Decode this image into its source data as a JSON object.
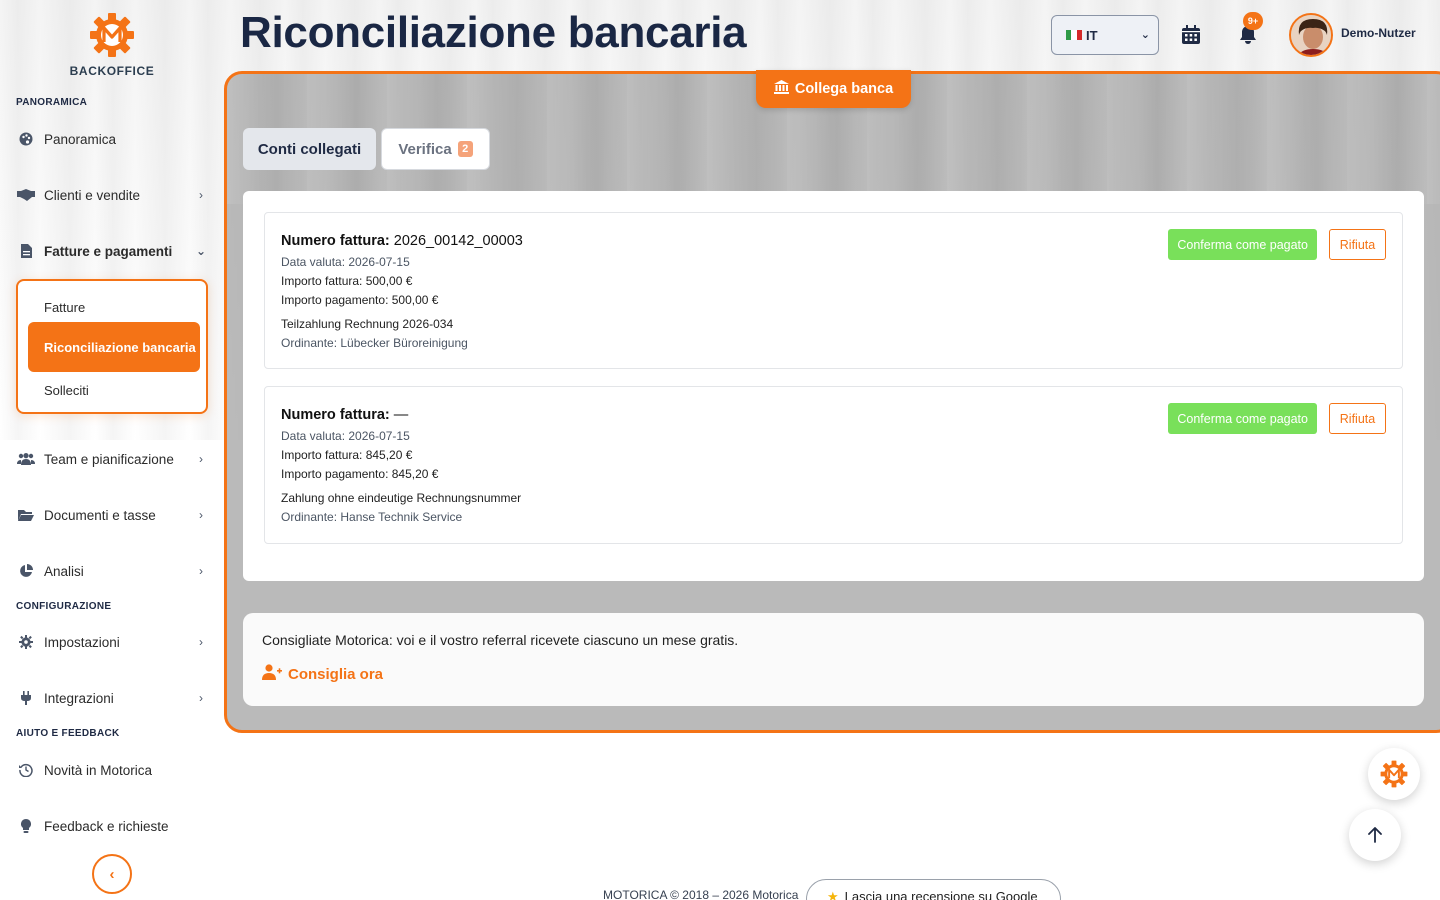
{
  "brand": {
    "logo_text": "BACKOFFICE",
    "accent": "#f47316"
  },
  "sidebar": {
    "sections": {
      "overview": "PANORAMICA",
      "config": "CONFIGURAZIONE",
      "help": "AIUTO E FEEDBACK"
    },
    "items": {
      "overview": {
        "label": "Panoramica",
        "icon": "palette-icon"
      },
      "clients": {
        "label": "Clienti e vendite",
        "icon": "handshake-icon"
      },
      "invoices": {
        "label": "Fatture e pagamenti",
        "icon": "invoice-icon"
      },
      "team": {
        "label": "Team e pianificazione",
        "icon": "users-icon"
      },
      "documents": {
        "label": "Documenti e tasse",
        "icon": "folder-icon"
      },
      "analytics": {
        "label": "Analisi",
        "icon": "pie-chart-icon"
      },
      "settings": {
        "label": "Impostazioni",
        "icon": "gear-icon"
      },
      "integrations": {
        "label": "Integrazioni",
        "icon": "plug-icon"
      },
      "news": {
        "label": "Novità in Motorica",
        "icon": "history-icon"
      },
      "feedback": {
        "label": "Feedback e richieste",
        "icon": "lightbulb-icon"
      }
    },
    "submenu": {
      "invoices": "Fatture",
      "reconciliation": "Riconciliazione bancaria",
      "reminders": "Solleciti"
    }
  },
  "header": {
    "title": "Riconciliazione bancaria",
    "language": "IT",
    "notifications_badge": "9+",
    "user_name": "Demo-Nutzer"
  },
  "main": {
    "connect_bank_label": "Collega banca",
    "tabs": {
      "linked": "Conti collegati",
      "verify": "Verifica",
      "verify_count": "2"
    },
    "transactions": [
      {
        "invoice_label": "Numero fattura:",
        "invoice_number": "2026_00142_00003",
        "value_date": "Data valuta: 2026-07-15",
        "invoice_amount": "Importo fattura: 500,00 €",
        "payment_amount": "Importo pagamento: 500,00 €",
        "purpose": "Teilzahlung Rechnung 2026-034",
        "payer": "Ordinante: Lübecker Büroreinigung",
        "confirm_label": "Conferma come pagato",
        "reject_label": "Rifiuta"
      },
      {
        "invoice_label": "Numero fattura:",
        "invoice_number": "—",
        "value_date": "Data valuta: 2026-07-15",
        "invoice_amount": "Importo fattura: 845,20 €",
        "payment_amount": "Importo pagamento: 845,20 €",
        "purpose": "Zahlung ohne eindeutige Rechnungsnummer",
        "payer": "Ordinante: Hanse Technik Service",
        "confirm_label": "Conferma come pagato",
        "reject_label": "Rifiuta"
      }
    ],
    "referral": {
      "text": "Consigliate Motorica: voi e il vostro referral ricevete ciascuno un mese gratis.",
      "link": "Consiglia ora"
    }
  },
  "footer": {
    "copyright": "MOTORICA © 2018 – 2026 Motorica",
    "review_label": "Lascia una recensione su Google"
  }
}
